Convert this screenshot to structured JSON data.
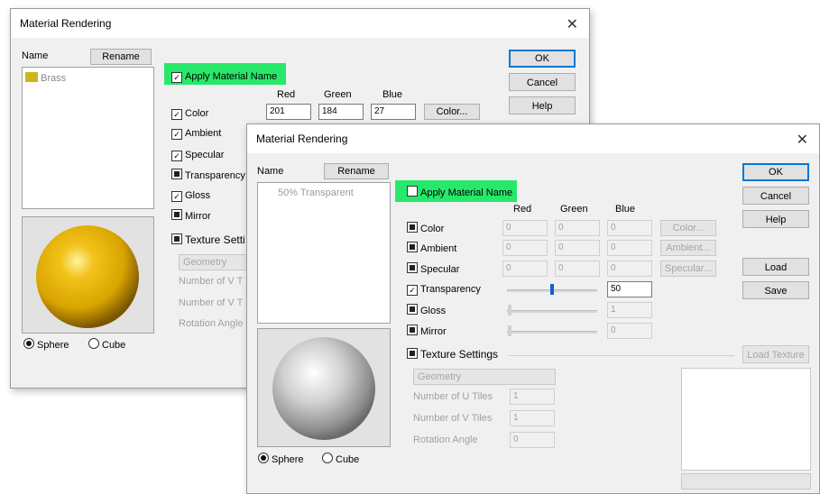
{
  "back": {
    "title": "Material Rendering",
    "name_label": "Name",
    "rename_label": "Rename",
    "list_items": [
      "Brass"
    ],
    "swatch_color": "#c9b81b",
    "apply_name_label": "Apply Material Name",
    "headers": {
      "red": "Red",
      "green": "Green",
      "blue": "Blue"
    },
    "color_values": {
      "red": "201",
      "green": "184",
      "blue": "27"
    },
    "color_button": "Color...",
    "props": [
      "Color",
      "Ambient",
      "Specular",
      "Transparency",
      "Gloss",
      "Mirror"
    ],
    "texture_label": "Texture Setti",
    "geometry_label": "Geometry",
    "tex_u": "Number of V T",
    "tex_v": "Number of V T",
    "rotation": "Rotation Angle",
    "ok": "OK",
    "cancel": "Cancel",
    "help": "Help",
    "sphere": "Sphere",
    "cube": "Cube"
  },
  "front": {
    "title": "Material Rendering",
    "name_label": "Name",
    "rename_label": "Rename",
    "list_items": [
      "50% Transparent"
    ],
    "apply_name_label": "Apply Material Name",
    "headers": {
      "red": "Red",
      "green": "Green",
      "blue": "Blue"
    },
    "rows": [
      {
        "label": "Color",
        "r": "0",
        "g": "0",
        "b": "0",
        "button": "Color..."
      },
      {
        "label": "Ambient",
        "r": "0",
        "g": "0",
        "b": "0",
        "button": "Ambient..."
      },
      {
        "label": "Specular",
        "r": "0",
        "g": "0",
        "b": "0",
        "button": "Specular..."
      },
      {
        "label": "Transparency",
        "value": "50"
      },
      {
        "label": "Gloss",
        "value": "1"
      },
      {
        "label": "Mirror",
        "value": "0"
      }
    ],
    "texture_label": "Texture Settings",
    "load_texture": "Load Texture",
    "geometry_label": "Geometry",
    "tex_u_label": "Number of U Tiles",
    "tex_u": "1",
    "tex_v_label": "Number of V Tiles",
    "tex_v": "1",
    "rotation_label": "Rotation Angle",
    "rotation": "0",
    "ok": "OK",
    "cancel": "Cancel",
    "help": "Help",
    "load": "Load",
    "save": "Save",
    "sphere": "Sphere",
    "cube": "Cube",
    "transparency_level": 0.5
  },
  "colors": {
    "highlight": "#27e86a",
    "brass": "#c9b81b",
    "slider_thumb": "#1060d0"
  }
}
